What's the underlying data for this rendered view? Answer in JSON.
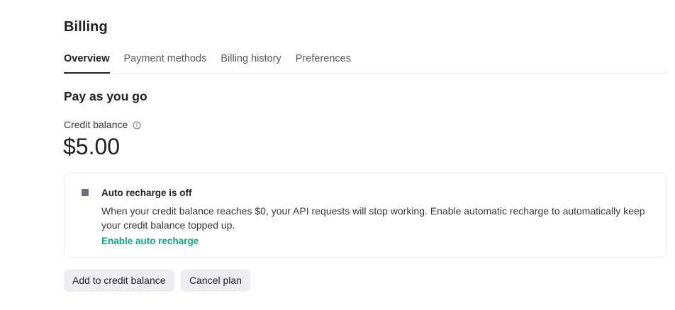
{
  "header": {
    "title": "Billing"
  },
  "tabs": [
    {
      "label": "Overview",
      "active": true
    },
    {
      "label": "Payment methods",
      "active": false
    },
    {
      "label": "Billing history",
      "active": false
    },
    {
      "label": "Preferences",
      "active": false
    }
  ],
  "plan": {
    "title": "Pay as you go",
    "credit_label": "Credit balance",
    "credit_info_icon": "info-circle-icon",
    "balance": "$5.00"
  },
  "auto_recharge": {
    "icon": "square-icon",
    "title": "Auto recharge is off",
    "body": "When your credit balance reaches $0, your API requests will stop working. Enable automatic recharge to automatically keep your credit balance topped up.",
    "link": "Enable auto recharge"
  },
  "actions": {
    "add_label": "Add to credit balance",
    "cancel_label": "Cancel plan"
  },
  "colors": {
    "link": "#10a37f",
    "button_bg": "#ececf1",
    "text": "#202123"
  }
}
